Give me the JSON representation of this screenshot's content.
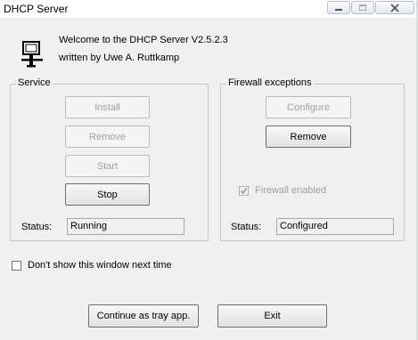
{
  "window": {
    "title": "DHCP Server",
    "controls": {
      "minimize_icon": "minimize-icon",
      "maximize_icon": "maximize-icon",
      "close_icon": "close-icon"
    }
  },
  "header": {
    "logo_icon": "network-computer-icon",
    "welcome": "Welcome to the DHCP Server V2.5.2.3",
    "author": "written by Uwe A. Ruttkamp"
  },
  "service": {
    "group_title": "Service",
    "buttons": [
      {
        "label": "Install",
        "enabled": false
      },
      {
        "label": "Remove",
        "enabled": false
      },
      {
        "label": "Start",
        "enabled": false
      },
      {
        "label": "Stop",
        "enabled": true
      }
    ],
    "status_label": "Status:",
    "status_value": "Running"
  },
  "firewall": {
    "group_title": "Firewall exceptions",
    "buttons": [
      {
        "label": "Configure",
        "enabled": false
      },
      {
        "label": "Remove",
        "enabled": true
      }
    ],
    "enabled_checkbox": {
      "label": "Firewall enabled",
      "checked": true,
      "enabled": false
    },
    "status_label": "Status:",
    "status_value": "Configured"
  },
  "options": {
    "dont_show_label": "Don't show this window next time",
    "dont_show_checked": false
  },
  "footer": {
    "tray_label": "Continue as tray app.",
    "exit_label": "Exit"
  },
  "colors": {
    "dialog_bg": "#f0f0f0",
    "disabled_text": "#a0a0a0"
  }
}
